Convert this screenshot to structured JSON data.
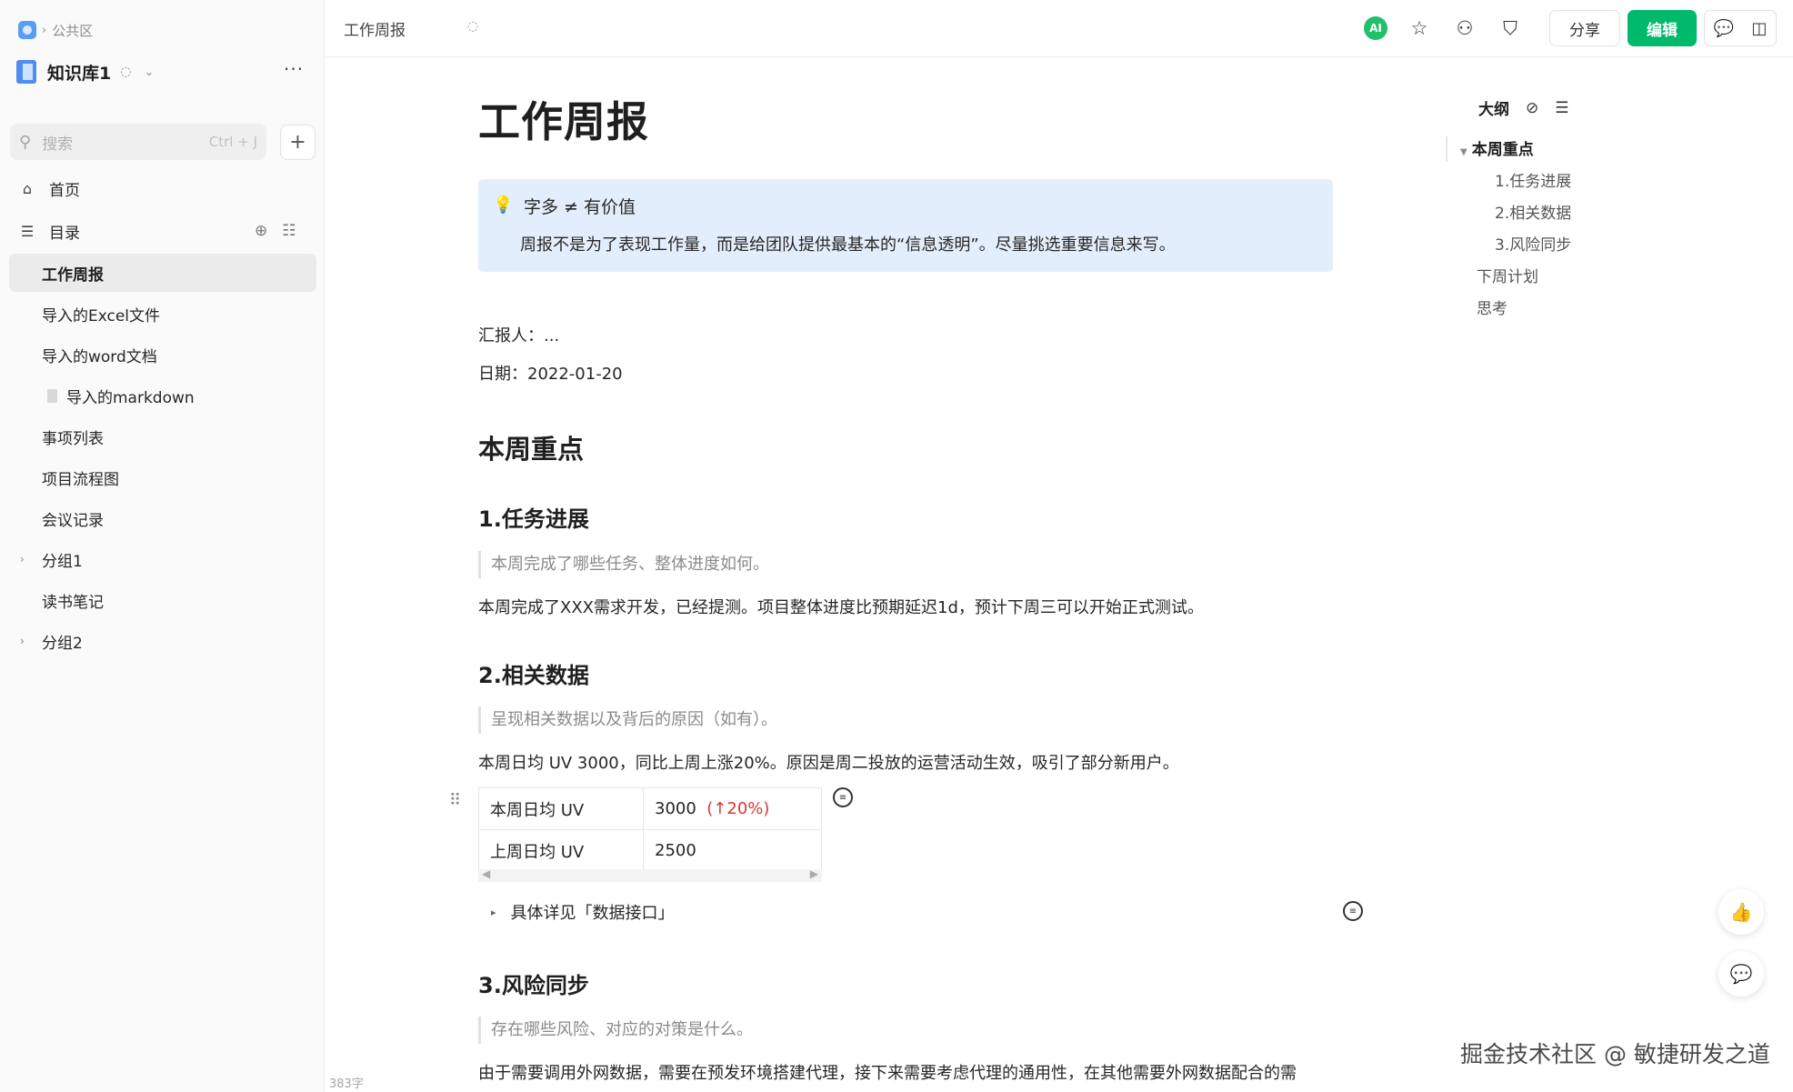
{
  "sidebar": {
    "breadcrumb": "公共区",
    "kb_name": "知识库1",
    "search_placeholder": "搜索",
    "search_hint": "Ctrl + J",
    "nav": [
      {
        "label": "首页"
      },
      {
        "label": "目录"
      }
    ],
    "items": [
      {
        "label": "工作周报",
        "active": true
      },
      {
        "label": "导入的Excel文件"
      },
      {
        "label": "导入的word文档"
      },
      {
        "label": "导入的markdown"
      },
      {
        "label": "事项列表"
      },
      {
        "label": "项目流程图"
      },
      {
        "label": "会议记录"
      },
      {
        "label": "分组1"
      },
      {
        "label": "读书笔记"
      },
      {
        "label": "分组2"
      }
    ],
    "word_count": "383字"
  },
  "header": {
    "title": "工作周报",
    "ai_label": "AI",
    "share": "分享",
    "edit": "编辑"
  },
  "doc": {
    "title": "工作周报",
    "callout_title": "字多 ≠ 有价值",
    "callout_text": "周报不是为了表现工作量，而是给团队提供最基本的“信息透明”。尽量挑选重要信息来写。",
    "reporter": "汇报人：...",
    "date": "日期：2022-01-20",
    "section": "本周重点",
    "s1_title": "1.任务进展",
    "s1_quote": "本周完成了哪些任务、整体进度如何。",
    "s1_text": "本周完成了XXX需求开发，已经提测。项目整体进度比预期延迟1d，预计下周三可以开始正式测试。",
    "s2_title": "2.相关数据",
    "s2_quote": "呈现相关数据以及背后的原因（如有）。",
    "s2_text": "本周日均 UV 3000，同比上周上涨20%。原因是周二投放的运营活动生效，吸引了部分新用户。",
    "table": [
      {
        "label": "本周日均 UV",
        "value": "3000",
        "change": "(↑20%)"
      },
      {
        "label": "上周日均 UV",
        "value": "2500",
        "change": ""
      }
    ],
    "toggle": "具体详见「数据接口」",
    "s3_title": "3.风险同步",
    "s3_quote": "存在哪些风险、对应的对策是什么。",
    "s3_text": "由于需要调用外网数据，需要在预发环境搭建代理，接下来需要考虑代理的通用性，在其他需要外网数据配合的需"
  },
  "outline": {
    "title": "大纲",
    "items": [
      "本周重点",
      "1.任务进展",
      "2.相关数据",
      "3.风险同步",
      "下周计划",
      "思考"
    ]
  },
  "watermark": "掘金技术社区 @ 敏捷研发之道"
}
